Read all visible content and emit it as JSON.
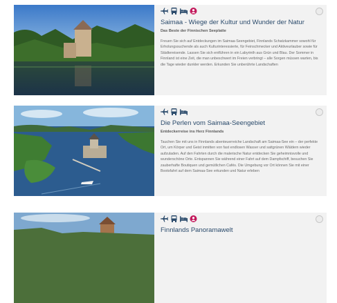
{
  "cards": [
    {
      "title": "Saimaa - Wiege der Kultur und Wunder der Natur",
      "subtitle": "Das Beste der Finnischen Seeplatte",
      "text": "Freuen Sie sich auf Entdeckungen im Saimaa-Seengebiet, Finnlands Schatzkammer sowohl für Erholungssuchende als auch Kulturinteressierte, für Feinschmecker und Aktiveurlauber sowie für Städtereisende. Lassen Sie sich entführen in ein Labyrinth aus Grün und Blau. Der Sommer in Finnland ist eine Zeit, die man unbeschwert im Freien verbringt – alle Sorgen müssen warten, bis die Tage wieder dunkler werden. Erkunden Sie unberührte Landschaften",
      "icons": [
        "plane-icon",
        "bus-icon",
        "bed-icon",
        "guide-icon"
      ]
    },
    {
      "title": "Die Perlen vom Saimaa-Seengebiet",
      "subtitle": "Entdeckerreise ins Herz Finnlands",
      "text": "Tauchen Sie mit uns in Finnlands abenteuerreiche Landschaft am Saimaa-See ein – der perfekte Ort, um Körper und Geist inmitten von fast endlosen Wasser und sattgrünen Wäldern wieder aufzuladen. Auf den Fahrten durch die malerische Natur entdecken Sie geheimnisvolle und wunderschöne Orte. Entspannen Sie während einer Fahrt auf dem Dampfschiff, besuchen Sie zauberhafte Boutiquen und gemütlichen Cafés. Die Umgebung vor Ort können Sie mit einer Bootsfahrt auf dem Saimaa-See erkunden und Natur erleben",
      "icons": [
        "plane-icon",
        "bus-icon",
        "bed-icon"
      ]
    },
    {
      "title": "Finnlands Panoramawelt",
      "subtitle": "",
      "text": "",
      "icons": [
        "plane-icon",
        "bus-icon",
        "bed-icon",
        "guide-icon"
      ]
    }
  ],
  "colors": {
    "icon": "#2a4a6b",
    "guide": "#c2185b",
    "card_bg": "#f2f2f2"
  }
}
